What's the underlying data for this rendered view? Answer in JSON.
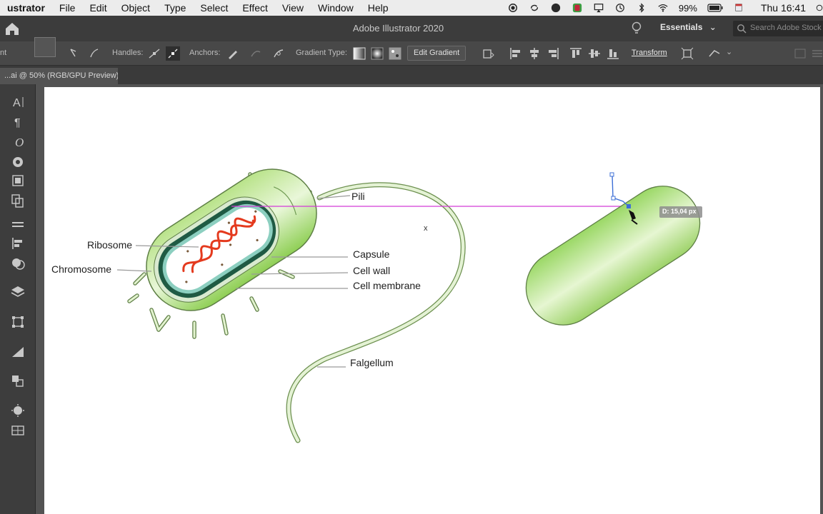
{
  "menubar": {
    "app_name": "ustrator",
    "items": [
      "File",
      "Edit",
      "Object",
      "Type",
      "Select",
      "Effect",
      "View",
      "Window",
      "Help"
    ],
    "battery": "99%",
    "clock": "Thu 16:41"
  },
  "titlebar": {
    "title": "Adobe Illustrator 2020",
    "workspace": "Essentials",
    "search_placeholder": "Search Adobe Stock"
  },
  "controlbar": {
    "handles_label": "Handles:",
    "anchors_label": "Anchors:",
    "gradient_type_label": "Gradient Type:",
    "edit_gradient": "Edit Gradient",
    "transform": "Transform"
  },
  "document": {
    "tab_title": "...ai @ 50% (RGB/GPU Preview)"
  },
  "diagram": {
    "labels": {
      "pili": "Pili",
      "ribosome": "Ribosome",
      "chromosome": "Chromosome",
      "capsule": "Capsule",
      "cell_wall": "Cell wall",
      "cell_membrane": "Cell membrane",
      "flagellum": "Falgellum"
    }
  },
  "tooltip": {
    "distance": "D: 15,04 px"
  },
  "colors": {
    "cell_green": "#a9dc78",
    "cell_green_light": "#d8f2b6",
    "membrane_dark": "#1f5a44",
    "dna_red": "#e43a1e",
    "smart_guide": "#d43ad8",
    "anchor_blue": "#3d6fd6"
  }
}
